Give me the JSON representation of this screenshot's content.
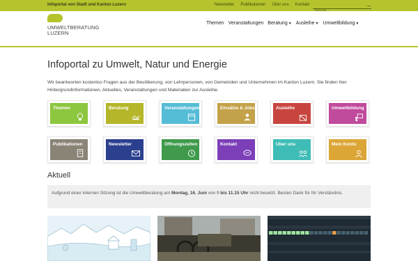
{
  "topbar": {
    "site_name": "Infoportal von Stadt und Kanton Luzern",
    "links": [
      "Newsletter",
      "Publikationen",
      "Über uns",
      "Kontakt"
    ],
    "search_placeholder": "Suche..."
  },
  "logo": {
    "line1": "UMWELTBERATUNG",
    "line2": "LUZERN"
  },
  "nav": [
    {
      "label": "Themen",
      "has_menu": false
    },
    {
      "label": "Veranstaltungen",
      "has_menu": false
    },
    {
      "label": "Beratung",
      "has_menu": true
    },
    {
      "label": "Ausleihe",
      "has_menu": true
    },
    {
      "label": "Umweltbildung",
      "has_menu": true
    }
  ],
  "page_title": "Infoportal zu Umwelt, Natur und Energie",
  "intro": "Wir beantworten kostenlos Fragen aus der Bevölkerung, von Lehrpersonen, von Gemeinden und Unternehmen im Kanton Luzern. Sie finden hier Hintergrundinformationen, Aktuelles, Veranstaltungen und Materialien zur Ausleihe.",
  "tiles": [
    {
      "label": "Themen",
      "color": "#8dc63f",
      "icon": "bulb-icon"
    },
    {
      "label": "Beratung",
      "color": "#b5b62a",
      "icon": "handshake-icon"
    },
    {
      "label": "Veranstaltungen",
      "color": "#55bcd6",
      "icon": "calendar-icon"
    },
    {
      "label": "Einsätze & Jobs",
      "color": "#c4a24a",
      "icon": "worker-icon"
    },
    {
      "label": "Ausleihe",
      "color": "#c8453f",
      "icon": "box-icon"
    },
    {
      "label": "Umweltbildung",
      "color": "#c04a9c",
      "icon": "teacher-icon"
    },
    {
      "label": "Publikationen",
      "color": "#8a8477",
      "icon": "document-icon"
    },
    {
      "label": "Newsletter",
      "color": "#2b3f8f",
      "icon": "mail-icon"
    },
    {
      "label": "Öffnungszeiten",
      "color": "#3f9a4c",
      "icon": "clock-icon"
    },
    {
      "label": "Kontakt",
      "color": "#7c3fb8",
      "icon": "chat-icon"
    },
    {
      "label": "Über uns",
      "color": "#3fbcb5",
      "icon": "people-icon"
    },
    {
      "label": "Mein Konto",
      "color": "#dca637",
      "icon": "account-icon"
    }
  ],
  "section_title": "Aktuell",
  "notice": {
    "part1": "Aufgrund einer internen Sitzung ist die Umweltberatung am ",
    "bold1": "Montag, 16. Juni",
    "part2": " von 9 ",
    "bold2": "bis 11.15 Uhr",
    "part3": " nicht besetzt. Besten Dank für Ihr Verständnis."
  }
}
